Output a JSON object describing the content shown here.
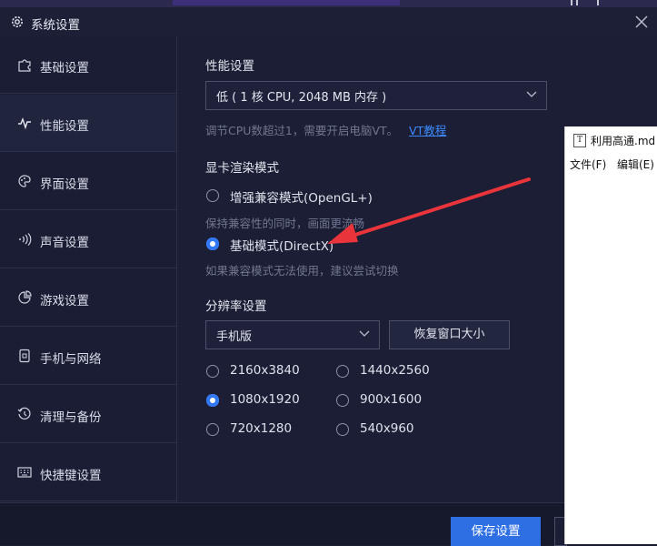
{
  "window": {
    "title": "系统设置"
  },
  "sidebar": {
    "items": [
      {
        "label": "基础设置",
        "icon": "puzzle-icon"
      },
      {
        "label": "性能设置",
        "icon": "pulse-icon",
        "active": true
      },
      {
        "label": "界面设置",
        "icon": "palette-icon"
      },
      {
        "label": "声音设置",
        "icon": "sound-wave-icon"
      },
      {
        "label": "游戏设置",
        "icon": "pie-icon"
      },
      {
        "label": "手机与网络",
        "icon": "phone-icon"
      },
      {
        "label": "清理与备份",
        "icon": "history-icon"
      },
      {
        "label": "快捷键设置",
        "icon": "keyboard-icon"
      }
    ]
  },
  "performance": {
    "heading": "性能设置",
    "selected": "低 ( 1 核 CPU, 2048 MB 内存 )",
    "hint": "调节CPU数超过1，需要开启电脑VT。",
    "hint_link": "VT教程"
  },
  "render": {
    "heading": "显卡渲染模式",
    "options": [
      {
        "label": "增强兼容模式(OpenGL+)",
        "desc": "保持兼容性的同时，画面更流畅",
        "selected": false
      },
      {
        "label": "基础模式(DirectX)",
        "desc": "如果兼容模式无法使用，建议尝试切换",
        "selected": true
      }
    ]
  },
  "resolution": {
    "heading": "分辨率设置",
    "device": "手机版",
    "restore_button": "恢复窗口大小",
    "options": [
      {
        "label": "2160x3840",
        "selected": false
      },
      {
        "label": "1440x2560",
        "selected": false
      },
      {
        "label": "1080x1920",
        "selected": true
      },
      {
        "label": "900x1600",
        "selected": false
      },
      {
        "label": "720x1280",
        "selected": false
      },
      {
        "label": "540x960",
        "selected": false
      }
    ]
  },
  "footer": {
    "save": "保存设置"
  },
  "notepad": {
    "title": "利用高通.md",
    "icon_letter": "T",
    "menu": [
      "文件(F)",
      "编辑(E)"
    ]
  },
  "colors": {
    "accent": "#2f6fe4",
    "annotation_arrow": "#e8343a",
    "background": "#1b1e34"
  }
}
